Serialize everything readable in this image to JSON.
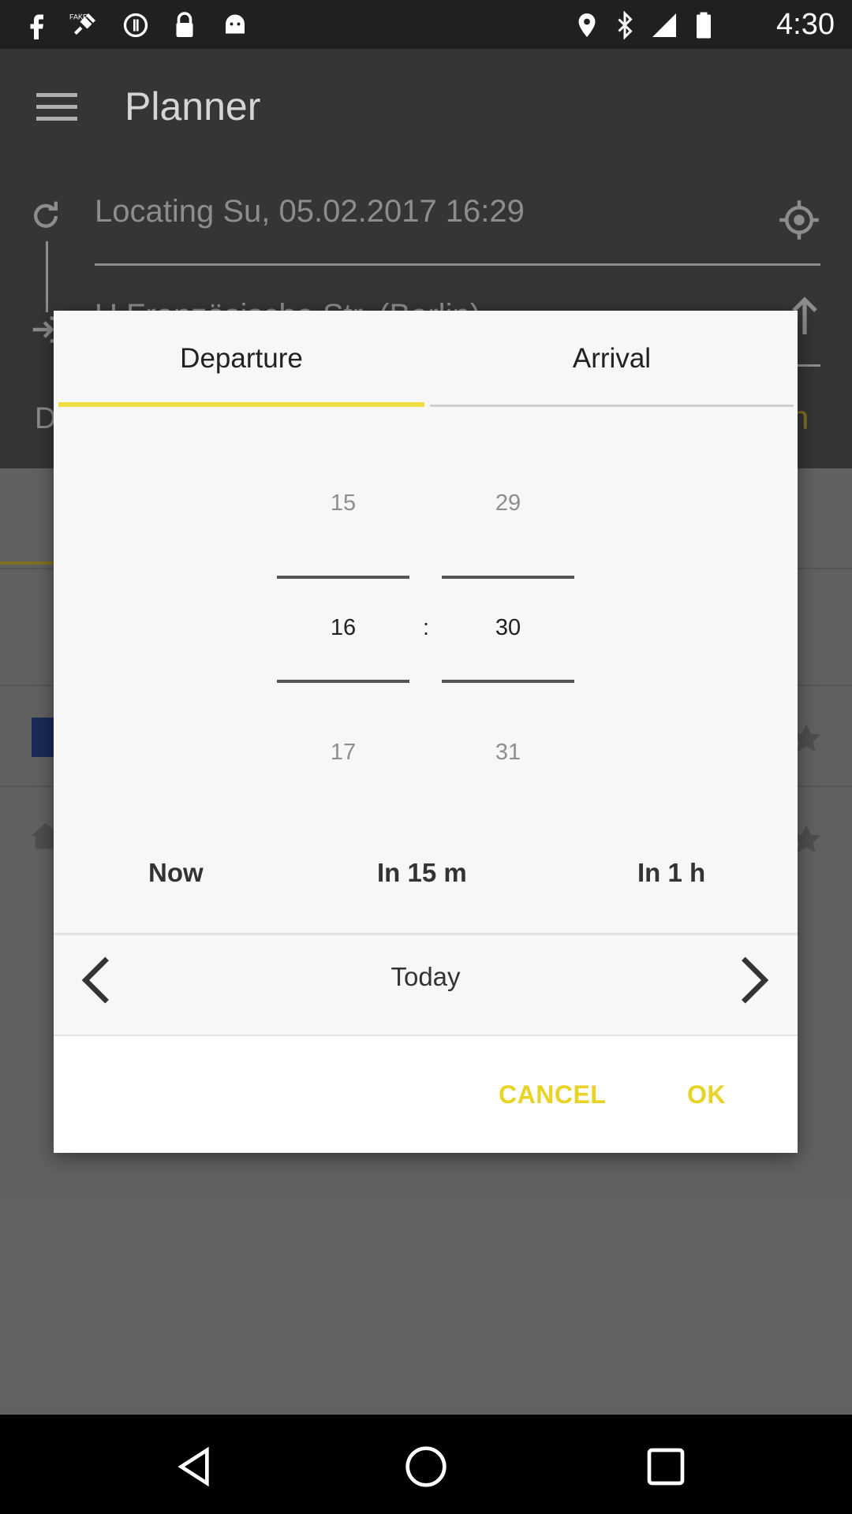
{
  "status_bar": {
    "time": "4:30",
    "left_icons": [
      "facebook-icon",
      "fake-gps-icon",
      "sync-icon",
      "lock-icon",
      "android-icon"
    ],
    "right_icons": [
      "location-icon",
      "bluetooth-icon",
      "signal-icon",
      "battery-icon"
    ]
  },
  "app_bar": {
    "title": "Planner",
    "menu_icon": "menu-icon"
  },
  "background": {
    "origin_text": "Locating Su, 05.02.2017 16:29",
    "destination_text": "U Französische Str. (Berlin)",
    "left_letter": "D",
    "right_letter": "h"
  },
  "dialog": {
    "tabs": [
      {
        "label": "Departure",
        "active": true
      },
      {
        "label": "Arrival",
        "active": false
      }
    ],
    "hours": {
      "prev": "15",
      "selected": "16",
      "next": "17"
    },
    "separator": ":",
    "minutes": {
      "prev": "29",
      "selected": "30",
      "next": "31"
    },
    "quick_options": [
      "Now",
      "In 15 m",
      "In 1 h"
    ],
    "day": "Today",
    "actions": {
      "cancel": "CANCEL",
      "ok": "OK"
    }
  },
  "colors": {
    "accent": "#f1de43",
    "action_text": "#e9d326",
    "dialog_bg": "#f7f7f7",
    "scrim": "#6a6a6a",
    "app_bar": "#3a3a3a"
  }
}
